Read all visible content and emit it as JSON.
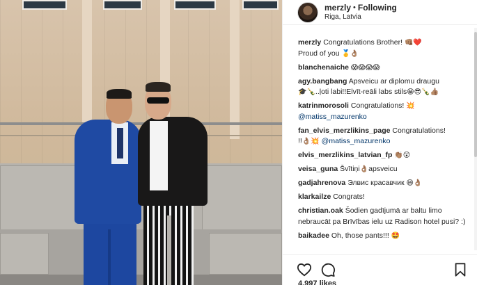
{
  "post": {
    "author": {
      "username": "merzly",
      "separator": "•",
      "follow_label": "Following",
      "location": "Riga, Latvia",
      "avatar_icon": "profile-photo"
    },
    "comments": [
      {
        "user": "merzly",
        "text": "Congratulations Brother!",
        "emoji": "👊🏽❤️",
        "text2": "Proud of you",
        "emoji2": "🥇👌🏽"
      },
      {
        "user": "blanchenaiche",
        "text": "",
        "emoji": "😱😱😱😱"
      },
      {
        "user": "agy.bangbang",
        "text": "Apsveicu ar diplomu draugu",
        "emoji": "🎓🍾",
        "text2": "..ļoti labi!!Elvīt-reāli labs stils",
        "emoji2": "😁😎🍾👍🏽"
      },
      {
        "user": "katrinmorosoli",
        "text": "Congratulations!",
        "emoji": "💥",
        "mention": "@matiss_mazurenko"
      },
      {
        "user": "fan_elvis_merzlikins_page",
        "text": "Congratulations!",
        "text2": "!!",
        "emoji2": "👌🏽💥",
        "mention": "@matiss_mazurenko"
      },
      {
        "user": "elvis_merzlikins_latvian_fp",
        "text": "",
        "emoji": "👏🏽😲"
      },
      {
        "user": "veisa_guna",
        "text": "Švītiņi",
        "emoji": "👌🏽",
        "text_after": "apsveicu"
      },
      {
        "user": "gadjahrenova",
        "text": "Элвис красавчик",
        "emoji": "😄👌🏽"
      },
      {
        "user": "klarkailze",
        "text": "Congrats!"
      },
      {
        "user": "christian.oak",
        "text": "Šodien gadījumā ar baltu limo nebraucāt pa Brīvības ielu uz Radison hotel pusi? :)"
      },
      {
        "user": "baikadee",
        "text": "Oh, those pants!!!",
        "emoji": "🤩"
      }
    ],
    "actions": {
      "like_icon": "heart-icon",
      "comment_icon": "comment-icon",
      "save_icon": "bookmark-icon"
    },
    "likes_text": "4,997 likes"
  }
}
